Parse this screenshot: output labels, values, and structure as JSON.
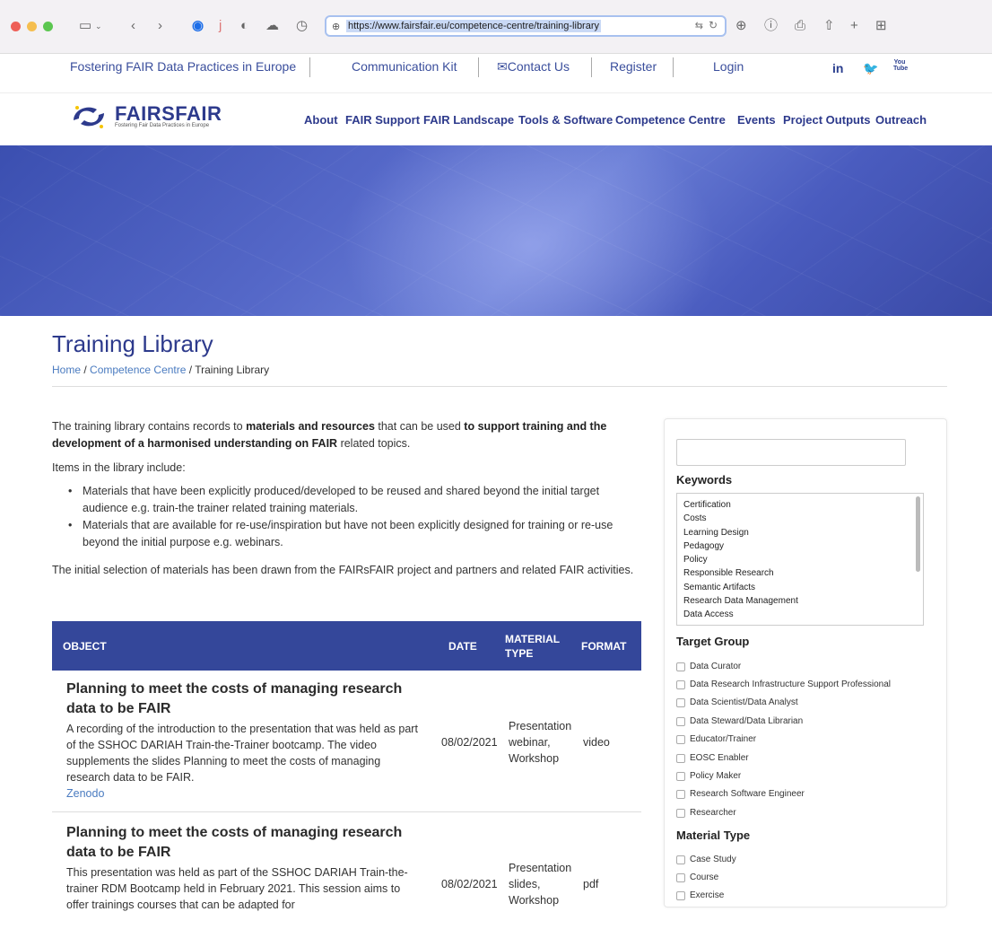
{
  "browser": {
    "url": "https://www.fairsfair.eu/competence-centre/training-library"
  },
  "topbar": {
    "tagline": "Fostering FAIR Data Practices in Europe",
    "communication_kit": "Communication Kit",
    "contact_us": "Contact Us",
    "register": "Register",
    "login": "Login",
    "social": [
      "in",
      "t",
      "You Tube"
    ]
  },
  "brand": {
    "name": "FAIRSFAIR",
    "sub": "Fostering Fair Data Practices in Europe"
  },
  "nav": {
    "items": [
      "About",
      "FAIR Support",
      "FAIR Landscape",
      "Tools & Software",
      "Competence Centre",
      "Events",
      "Project Outputs",
      "Outreach"
    ]
  },
  "page": {
    "title": "Training Library",
    "breadcrumb": {
      "home": "Home",
      "competence_centre": "Competence Centre",
      "current": "Training Library",
      "sep": " / "
    }
  },
  "main": {
    "intro_1": "The training library contains records to ",
    "intro_b1": "materials and resources",
    "intro_2": " that can be used ",
    "intro_b2": "to support training and the development of a harmonised understanding on FAIR",
    "intro_3": " related topics.",
    "items_label": "Items in the library include:",
    "bullets": [
      "Materials that have been explicitly produced/developed to be reused and shared beyond the initial target audience e.g. train-the trainer related training materials.",
      "Materials that are available for re-use/inspiration but have not been explicitly designed for training or re-use beyond the initial purpose e.g. webinars."
    ],
    "selection": "The initial selection of materials has been drawn from the FAIRsFAIR project and partners and related FAIR activities."
  },
  "table": {
    "headers": {
      "object": "OBJECT",
      "date": "DATE",
      "material_type_1": "MATERIAL",
      "material_type_2": "TYPE",
      "format": "FORMAT"
    },
    "rows": [
      {
        "title": "Planning to meet the costs of managing research data to be FAIR",
        "description": "A recording of the introduction to the presentation that was held as part of the SSHOC DARIAH Train-the-Trainer bootcamp. The video supplements the slides Planning to meet the costs of managing research data to be FAIR.",
        "source": "Zenodo",
        "date": "08/02/2021",
        "type_1": "Presentation",
        "type_2": "webinar,",
        "type_3": "Workshop",
        "format": "video"
      },
      {
        "title": "Planning to meet the costs of managing research data to be FAIR",
        "description": "This presentation was held as part of the SSHOC DARIAH Train-the-trainer RDM Bootcamp held in February 2021. This session aims to offer trainings courses that can be adapted for",
        "source": "",
        "date": "08/02/2021",
        "type_1": "Presentation",
        "type_2": "slides,",
        "type_3": "Workshop",
        "format": "pdf"
      }
    ]
  },
  "sidebar": {
    "search_value": "",
    "keywords_heading": "Keywords",
    "keywords": [
      "Certification",
      "Costs",
      "Learning Design",
      "Pedagogy",
      "Policy",
      "Responsible Research",
      "Semantic Artifacts",
      "Research Data Management",
      "Data Access"
    ],
    "target_group_heading": "Target Group",
    "target_groups": [
      "Data Curator",
      "Data Research Infrastructure Support Professional",
      "Data Scientist/Data Analyst",
      "Data Steward/Data Librarian",
      "Educator/Trainer",
      "EOSC Enabler",
      "Policy Maker",
      "Research Software Engineer",
      "Researcher"
    ],
    "material_type_heading": "Material Type",
    "material_types": [
      "Case Study",
      "Course",
      "Exercise"
    ]
  },
  "colors": {
    "brand_blue": "#2d3a8c",
    "table_header": "#34479a",
    "link": "#4a7bc0"
  }
}
